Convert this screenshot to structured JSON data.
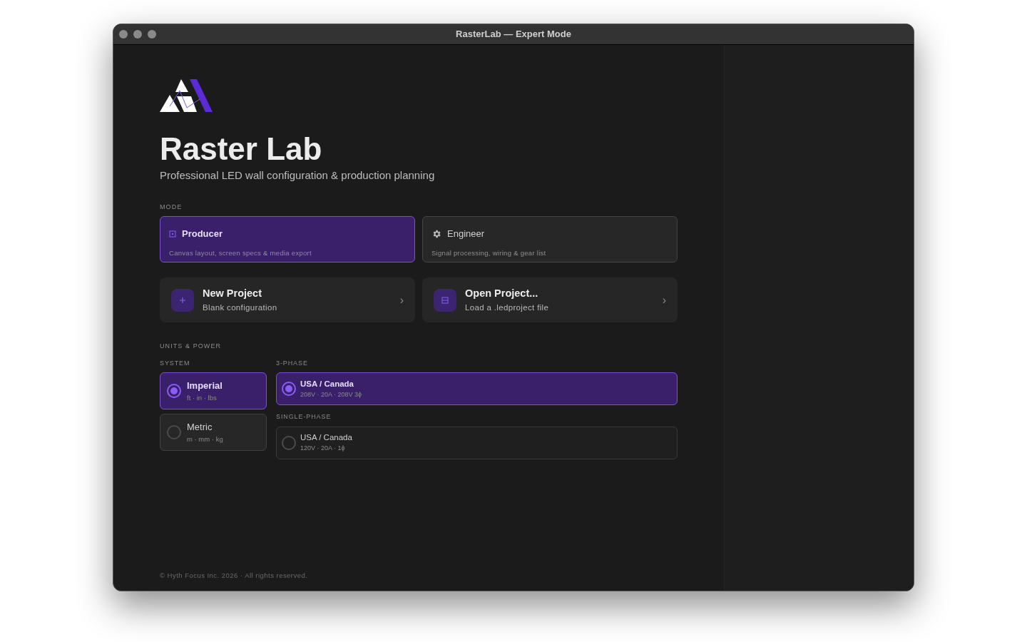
{
  "window": {
    "title": "RasterLab — Expert Mode"
  },
  "brand": {
    "title": "Raster Lab",
    "subtitle": "Professional LED wall configuration & production planning"
  },
  "mode": {
    "label": "MODE",
    "options": [
      {
        "title": "Producer",
        "description": "Canvas layout, screen specs & media export",
        "selected": true
      },
      {
        "title": "Engineer",
        "description": "Signal processing, wiring & gear list",
        "selected": false
      }
    ]
  },
  "actions": [
    {
      "title": "New Project",
      "subtitle": "Blank configuration",
      "chevron": "›"
    },
    {
      "title": "Open Project...",
      "subtitle": "Load a .ledproject file",
      "chevron": "›"
    }
  ],
  "units_power": {
    "label": "UNITS & POWER",
    "system": {
      "label": "SYSTEM",
      "options": [
        {
          "title": "Imperial",
          "detail": "ft · in · lbs",
          "selected": true
        },
        {
          "title": "Metric",
          "detail": "m · mm · kg",
          "selected": false
        }
      ]
    },
    "power_groups": [
      {
        "label": "3-PHASE",
        "options": [
          {
            "title": "USA / Canada",
            "detail": "208V · 20A · 208V 3ϕ",
            "selected": true
          }
        ]
      },
      {
        "label": "SINGLE-PHASE",
        "options": [
          {
            "title": "USA / Canada",
            "detail": "120V · 20A · 1ϕ",
            "selected": false
          }
        ]
      }
    ]
  },
  "footer": "© Hyth Focus Inc. 2026 · All rights reserved."
}
